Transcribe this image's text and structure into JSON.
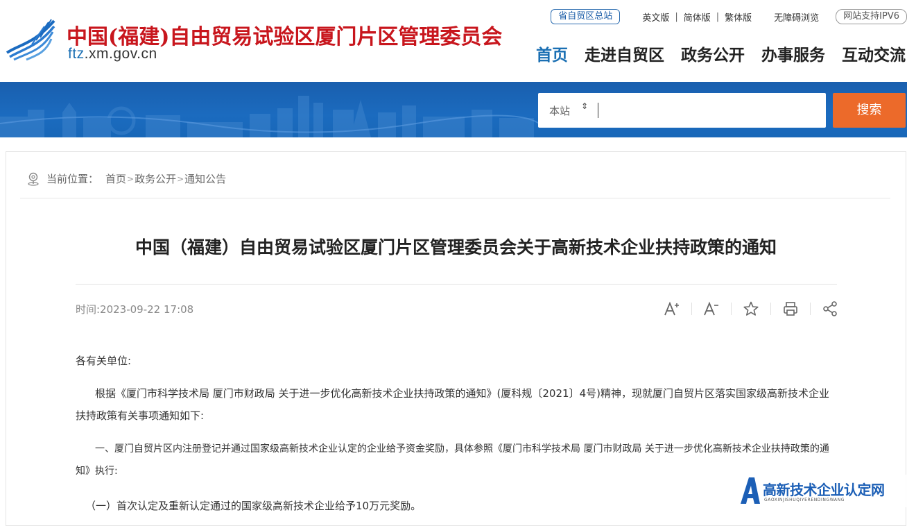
{
  "header": {
    "site_title": "中国(福建)自由贸易试验区厦门片区管理委员会",
    "domain_prefix": "ftz",
    "domain_rest": ".xm.gov.cn",
    "top_links": {
      "provincial": "省自贸区总站",
      "english": "英文版",
      "simplified": "简体版",
      "traditional": "繁体版",
      "accessible": "无障碍浏览",
      "ipv6": "网站支持IPV6",
      "separator": "|"
    },
    "nav": [
      "首页",
      "走进自贸区",
      "政务公开",
      "办事服务",
      "互动交流"
    ]
  },
  "search": {
    "scope": "本站",
    "scope_arrow": "⇕",
    "button": "搜索"
  },
  "breadcrumb": {
    "label": "当前位置：",
    "items": [
      "首页",
      "政务公开",
      "通知公告"
    ],
    "separator": ">"
  },
  "article": {
    "title": "中国（福建）自由贸易试验区厦门片区管理委员会关于高新技术企业扶持政策的通知",
    "time": "时间:2023-09-22 17:08",
    "paragraphs": [
      "各有关单位:",
      "根据《厦门市科学技术局 厦门市财政局 关于进一步优化高新技术企业扶持政策的通知》(厦科规〔2021〕4号)精神，现就厦门自贸片区落实国家级高新技术企业扶持政策有关事项通知如下:",
      "一、厦门自贸片区内注册登记并通过国家级高新技术企业认定的企业给予资金奖励，具体参照《厦门市科学技术局 厦门市财政局 关于进一步优化高新技术企业扶持政策的通知》执行:",
      "（一）首次认定及重新认定通过的国家级高新技术企业给予10万元奖励。"
    ]
  },
  "watermark": {
    "text": "高新技术企业认定网",
    "sub": "GAOXINJISHUQIYERENDINGWANG"
  },
  "colors": {
    "brand_red": "#c8161d",
    "brand_blue": "#1a6fb3",
    "search_button": "#ec6a2a"
  }
}
